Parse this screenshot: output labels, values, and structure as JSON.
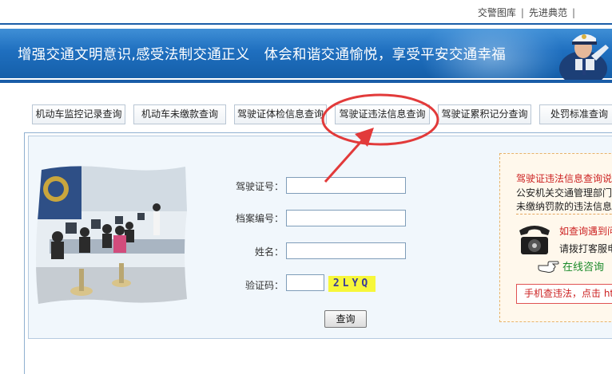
{
  "top_links": {
    "gallery": "交警图库",
    "exemplary": "先进典范",
    "separator": "|"
  },
  "banner": {
    "slogan": "增强交通文明意识,感受法制交通正义　体会和谐交通愉悦，享受平安交通幸福"
  },
  "tabs": [
    {
      "label": "机动车监控记录查询"
    },
    {
      "label": "机动车未缴款查询"
    },
    {
      "label": "驾驶证体检信息查询"
    },
    {
      "label": "驾驶证违法信息查询"
    },
    {
      "label": "驾驶证累积记分查询"
    },
    {
      "label": "处罚标准查询"
    }
  ],
  "form": {
    "license_label": "驾驶证号：",
    "license_value": "",
    "file_label": "档案编号：",
    "file_value": "",
    "name_label": "姓名：",
    "name_value": "",
    "captcha_label": "验证码：",
    "captcha_value": "",
    "captcha_text": "2LYQ",
    "submit_label": "查询"
  },
  "notice": {
    "title": "驾驶证违法信息查询说",
    "line1": "公安机关交通管理部门",
    "line2": "未缴纳罚款的违法信息",
    "help_title": "如查询遇到问",
    "help_text": "请拨打客服电",
    "online_label": "在线咨询",
    "mobile_label": "手机查违法，点击 htt"
  },
  "colors": {
    "banner_blue": "#1f6fbf",
    "annotation_red": "#e23a3a",
    "notice_red": "#cc2222",
    "online_green": "#1a8a2a",
    "captcha_yellow": "#f7f73a"
  }
}
